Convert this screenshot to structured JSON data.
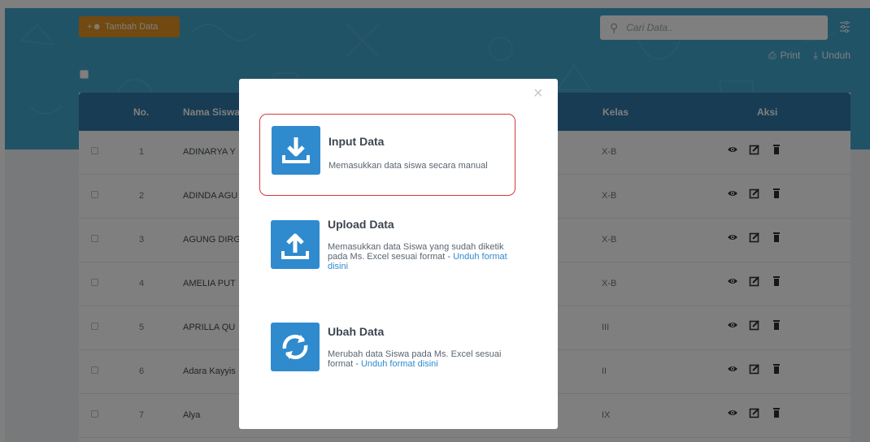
{
  "toolbar": {
    "add_label": "Tambah Data",
    "search_placeholder": "Cari Data..",
    "print_label": "Print",
    "download_label": "Unduh"
  },
  "table": {
    "headers": {
      "no": "No.",
      "name": "Nama Siswa",
      "class": "Kelas",
      "actions": "Aksi"
    },
    "rows": [
      {
        "no": "1",
        "name": "ADINARYA Y",
        "kelas": "X-B"
      },
      {
        "no": "2",
        "name": "ADINDA AGU",
        "kelas": "X-B"
      },
      {
        "no": "3",
        "name": "AGUNG DIRG",
        "kelas": "X-B"
      },
      {
        "no": "4",
        "name": "AMELIA PUT",
        "kelas": "X-B"
      },
      {
        "no": "5",
        "name": "APRILLA QU",
        "kelas": "III"
      },
      {
        "no": "6",
        "name": "Adara Kayyis",
        "kelas": "II"
      },
      {
        "no": "7",
        "name": "Alya",
        "kelas": "IX"
      }
    ]
  },
  "modal": {
    "close": "×",
    "options": [
      {
        "title": "Input Data",
        "desc": "Memasukkan data siswa secara manual",
        "link": ""
      },
      {
        "title": "Upload Data",
        "desc": "Memasukkan data Siswa yang sudah diketik pada Ms. Excel sesuai format - ",
        "link": "Unduh format disini"
      },
      {
        "title": "Ubah Data",
        "desc": "Merubah data Siswa pada Ms. Excel sesuai format - ",
        "link": "Unduh format disini"
      }
    ]
  },
  "colors": {
    "hero": "#43a6cf",
    "header": "#2f78a9",
    "accent": "#2f8ace",
    "add_button": "#e39222",
    "highlight": "#d23a3a"
  }
}
